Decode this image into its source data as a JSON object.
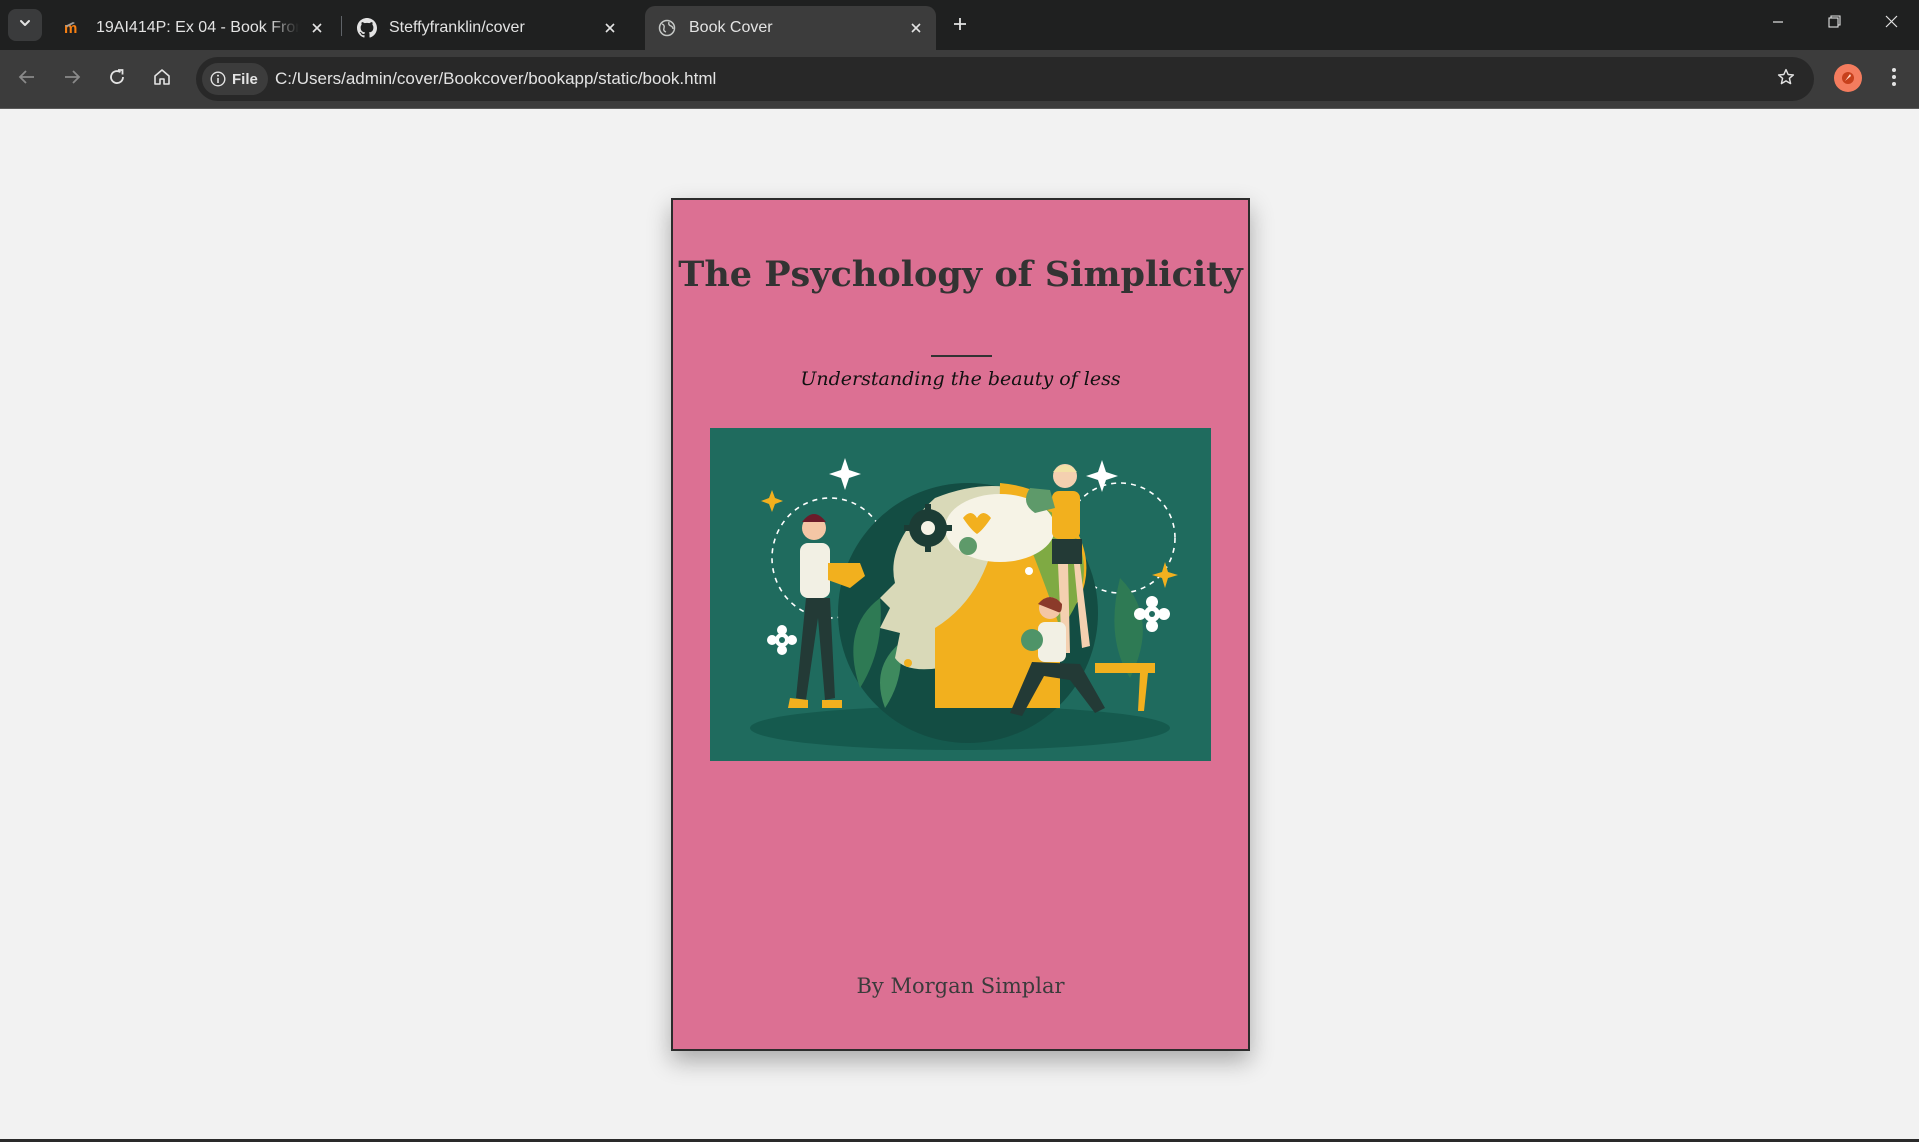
{
  "browser": {
    "tabs": [
      {
        "title": "19AI414P: Ex 04 - Book Front C",
        "icon": "moodle-icon",
        "active": false
      },
      {
        "title": "Steffyfranklin/cover",
        "icon": "github-icon",
        "active": false
      },
      {
        "title": "Book Cover",
        "icon": "globe-icon",
        "active": true
      }
    ],
    "address": {
      "chip_label": "File",
      "url": "C:/Users/admin/cover/Bookcover/bookapp/static/book.html"
    },
    "accent_avatar": "#f47c5e"
  },
  "book": {
    "title": "The Psychology of Simplicity",
    "subtitle": "Understanding the beauty of less",
    "author": "By Morgan Simplar",
    "cover_color": "#dc7093",
    "illustration_background": "#1f6b5e"
  }
}
